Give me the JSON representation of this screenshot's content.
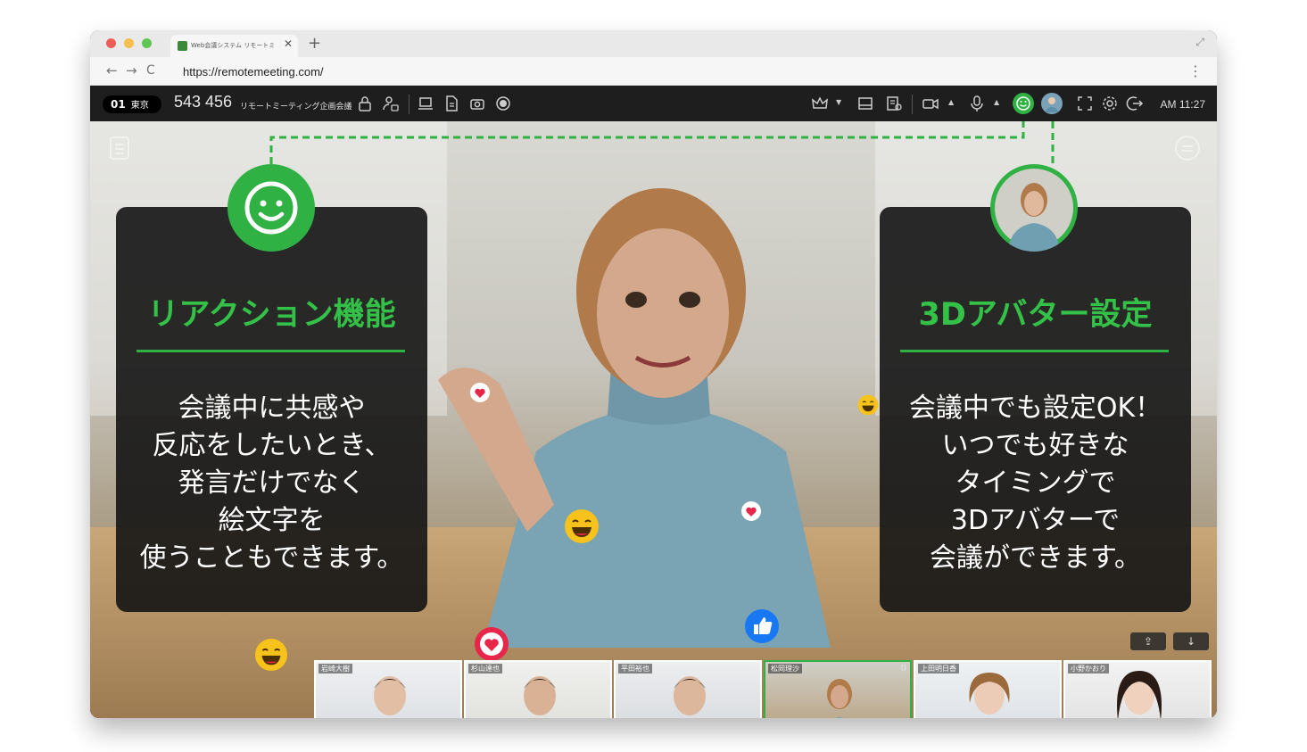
{
  "browser": {
    "tab_title": "Web会議システム リモートミ",
    "tab_close": "✕",
    "new_tab": "+",
    "url": "https://remotemeeting.com/",
    "colors": {
      "close": "#ed5f56",
      "minimize": "#f5bf4f",
      "zoom": "#5fc654"
    }
  },
  "toolbar": {
    "room_number": "01",
    "room_name": "東京",
    "meeting_id": "543 456",
    "meeting_name": "リモートミーティング企画会議",
    "clock": "AM 11:27",
    "left_icons": [
      "lock-icon",
      "user-lock-icon",
      "laptop-icon",
      "document-icon",
      "camera-icon",
      "record-icon"
    ],
    "right_icons": [
      "crown-icon",
      "layout-icon",
      "memo-icon",
      "video-icon",
      "mic-icon",
      "reaction-icon",
      "avatar-icon",
      "fullscreen-icon",
      "settings-icon",
      "exit-icon"
    ]
  },
  "left_panel": {
    "title": "リアクション機能",
    "lines": [
      "会議中に共感や",
      "反応をしたいとき、",
      "発言だけでなく",
      "絵文字を",
      "使うこともできます。"
    ]
  },
  "right_panel": {
    "title": "3Dアバター設定",
    "lines": [
      "会議中でも設定OK！",
      "いつでも好きな",
      "タイミングで",
      "3Dアバターで",
      "会議ができます。"
    ]
  },
  "thumbnails": [
    {
      "name": "岩崎大樹",
      "active": false
    },
    {
      "name": "杉山達也",
      "active": false
    },
    {
      "name": "平田裕也",
      "active": false
    },
    {
      "name": "松岡理沙",
      "active": true
    },
    {
      "name": "上田明日香",
      "active": false
    },
    {
      "name": "小野かおり",
      "active": false
    }
  ],
  "colors": {
    "accent": "#2fb144",
    "title_green": "#33c247",
    "heart": "#e8264a",
    "like": "#1877f2",
    "emoji": "#f7c21b"
  }
}
